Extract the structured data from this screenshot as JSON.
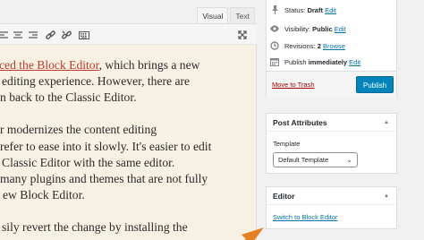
{
  "editor": {
    "tabs": [
      {
        "label": "Visual",
        "active": true
      },
      {
        "label": "Text",
        "active": false
      }
    ],
    "toolbar_icons": [
      "align-left-icon",
      "align-center-icon",
      "align-right-icon",
      "link-icon",
      "unlink-icon",
      "keyboard-icon",
      "fullscreen-icon"
    ],
    "lines": [
      {
        "link": "ced the Block Editor",
        "text": ", which brings a new"
      },
      {
        "link": "",
        "text": "editing experience. However, there are"
      },
      {
        "link": "",
        "text": "n back to the Classic Editor."
      },
      {
        "link": "",
        "text": "r modernizes the content editing"
      },
      {
        "link": "",
        "text": "refer to ease into it slowly. It's easier to edit"
      },
      {
        "link": "",
        "text": "Classic Editor with the same editor."
      },
      {
        "link": "",
        "text": "many plugins and themes that are not fully"
      },
      {
        "link": "",
        "text": "ew Block Editor."
      },
      {
        "link": "",
        "text": "sily revert the change by installing the"
      }
    ]
  },
  "publish": {
    "status_label": "Status:",
    "status_value": "Draft",
    "status_edit": "Edit",
    "visibility_label": "Visibility:",
    "visibility_value": "Public",
    "visibility_edit": "Edit",
    "revisions_label": "Revisions:",
    "revisions_value": "2",
    "revisions_browse": "Browse",
    "publish_label": "Publish",
    "publish_value": "immediately",
    "publish_edit": "Edit",
    "trash_label": "Move to Trash",
    "publish_button": "Publish"
  },
  "post_attributes": {
    "title": "Post Attributes",
    "template_label": "Template",
    "template_value": "Default Template"
  },
  "editor_box": {
    "title": "Editor",
    "switch_label": "Switch to Block Editor"
  },
  "colors": {
    "accent": "#0085ba",
    "link": "#0073aa",
    "trash": "#aa0000",
    "arrow": "#e67e22",
    "content_bg": "#f7f1e3"
  }
}
